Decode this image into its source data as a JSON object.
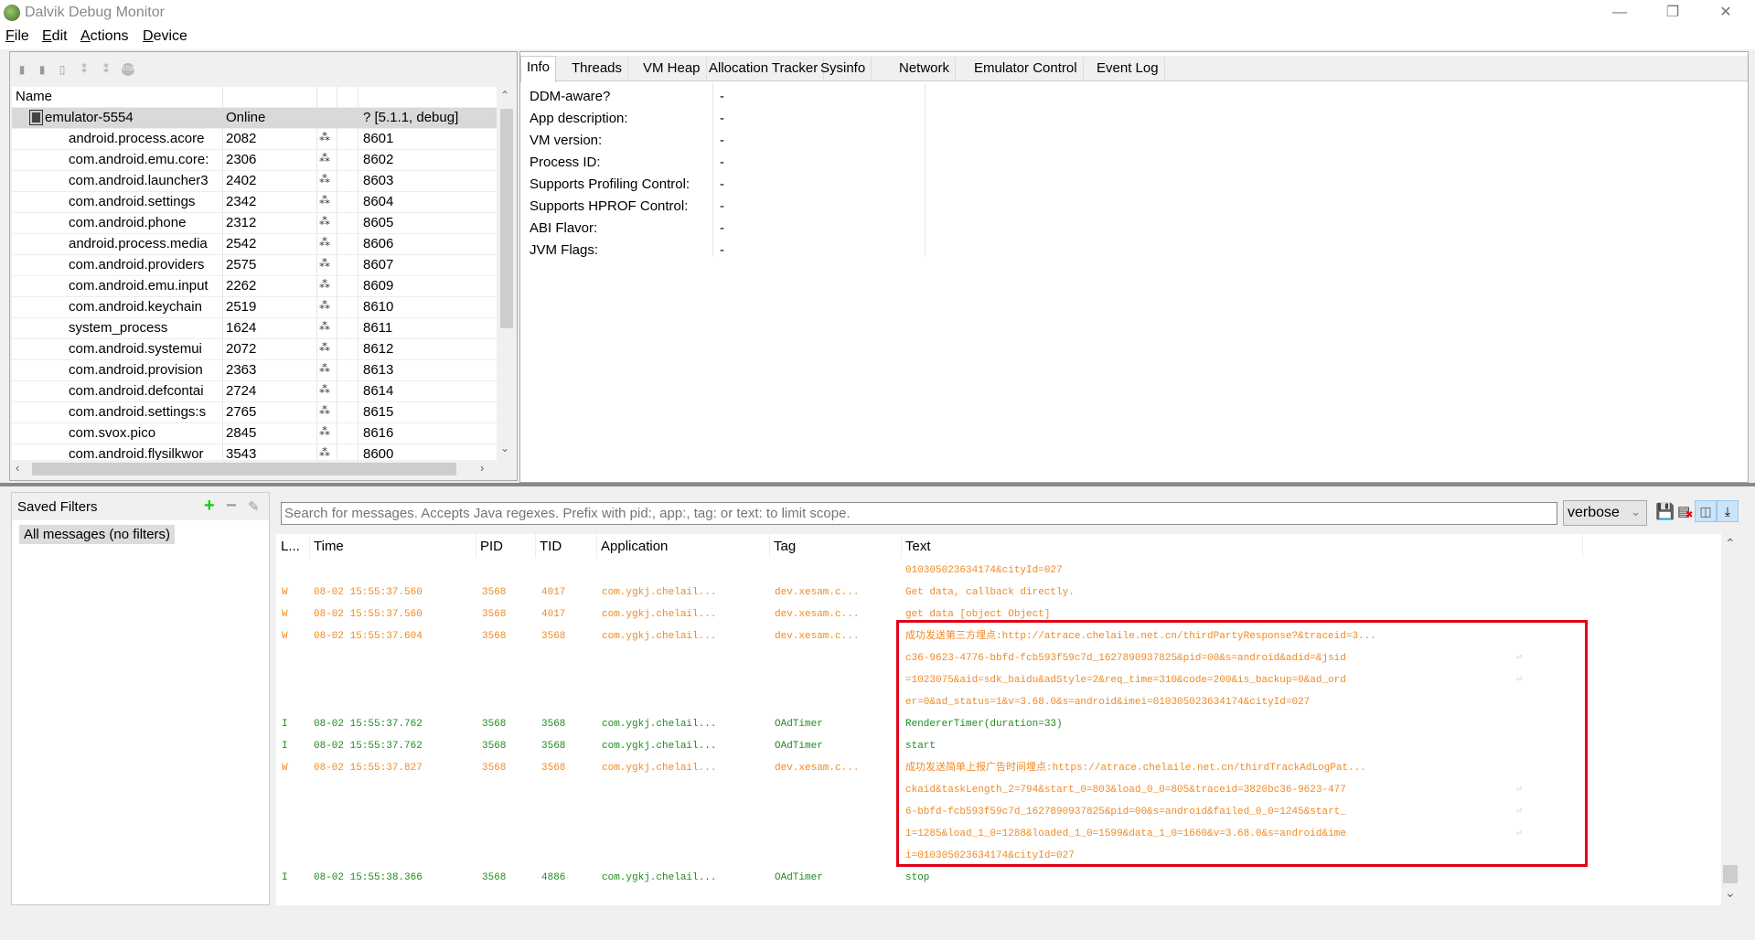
{
  "window": {
    "title": "Dalvik Debug Monitor",
    "minimize": "—",
    "maximize": "❐",
    "close": "✕"
  },
  "menu": [
    {
      "key": "F",
      "rest": "ile"
    },
    {
      "key": "E",
      "rest": "dit"
    },
    {
      "key": "A",
      "rest": "ctions"
    },
    {
      "key": "D",
      "rest": "evice"
    }
  ],
  "devices": {
    "header": {
      "name": "Name"
    },
    "device": {
      "name": "emulator-5554",
      "status": "Online",
      "version": "? [5.1.1, debug]"
    },
    "processes": [
      {
        "name": "android.process.acore",
        "pid": "2082",
        "port": "8601"
      },
      {
        "name": "com.android.emu.core:",
        "pid": "2306",
        "port": "8602"
      },
      {
        "name": "com.android.launcher3",
        "pid": "2402",
        "port": "8603"
      },
      {
        "name": "com.android.settings",
        "pid": "2342",
        "port": "8604"
      },
      {
        "name": "com.android.phone",
        "pid": "2312",
        "port": "8605"
      },
      {
        "name": "android.process.media",
        "pid": "2542",
        "port": "8606"
      },
      {
        "name": "com.android.providers",
        "pid": "2575",
        "port": "8607"
      },
      {
        "name": "com.android.emu.input",
        "pid": "2262",
        "port": "8609"
      },
      {
        "name": "com.android.keychain",
        "pid": "2519",
        "port": "8610"
      },
      {
        "name": "system_process",
        "pid": "1624",
        "port": "8611"
      },
      {
        "name": "com.android.systemui",
        "pid": "2072",
        "port": "8612"
      },
      {
        "name": "com.android.provision",
        "pid": "2363",
        "port": "8613"
      },
      {
        "name": "com.android.defcontai",
        "pid": "2724",
        "port": "8614"
      },
      {
        "name": "com.android.settings:s",
        "pid": "2765",
        "port": "8615"
      },
      {
        "name": "com.svox.pico",
        "pid": "2845",
        "port": "8616"
      },
      {
        "name": "com.android.flysilkwor",
        "pid": "3543",
        "port": "8600"
      }
    ]
  },
  "tabs": [
    "Info",
    "Threads",
    "VM Heap",
    "Allocation Tracker",
    "Sysinfo",
    "Network",
    "Emulator Control",
    "Event Log"
  ],
  "info": [
    {
      "label": "DDM-aware?",
      "value": "-"
    },
    {
      "label": "App description:",
      "value": "-"
    },
    {
      "label": "VM version:",
      "value": "-"
    },
    {
      "label": "Process ID:",
      "value": "-"
    },
    {
      "label": "Supports Profiling Control:",
      "value": "-"
    },
    {
      "label": "Supports HPROF Control:",
      "value": "-"
    },
    {
      "label": "ABI Flavor:",
      "value": "-"
    },
    {
      "label": "JVM Flags:",
      "value": "-"
    }
  ],
  "filters": {
    "title": "Saved Filters",
    "items": [
      "All messages (no filters)"
    ]
  },
  "logcat": {
    "search_placeholder": "Search for messages. Accepts Java regexes. Prefix with pid:, app:, tag: or text: to limit scope.",
    "level_select": "verbose",
    "columns": [
      "L...",
      "Time",
      "PID",
      "TID",
      "Application",
      "Tag",
      "Text"
    ],
    "colors": {
      "W": "#f08a24",
      "I": "#1e8c1e",
      "highlight": "#e00018"
    },
    "entries": [
      {
        "level": "",
        "time": "",
        "pid": "",
        "tid": "",
        "app": "",
        "tag": "",
        "lines": [
          "010305023634174&cityId=027"
        ],
        "cls": "W"
      },
      {
        "level": "W",
        "time": "08-02 15:55:37.560",
        "pid": "3568",
        "tid": "4017",
        "app": "com.ygkj.chelail...",
        "tag": "dev.xesam.c...",
        "lines": [
          "Get data, callback directly."
        ],
        "cls": "W"
      },
      {
        "level": "W",
        "time": "08-02 15:55:37.560",
        "pid": "3568",
        "tid": "4017",
        "app": "com.ygkj.chelail...",
        "tag": "dev.xesam.c...",
        "lines": [
          "get data [object Object]"
        ],
        "cls": "W"
      },
      {
        "level": "W",
        "time": "08-02 15:55:37.604",
        "pid": "3568",
        "tid": "3568",
        "app": "com.ygkj.chelail...",
        "tag": "dev.xesam.c...",
        "lines": [
          "成功发送第三方埋点:http://atrace.chelaile.net.cn/thirdPartyResponse?&traceid=3...",
          "c36-9623-4776-bbfd-fcb593f59c7d_1627890937825&pid=00&s=android&adid=&jsid",
          "=1023075&aid=sdk_baidu&adStyle=2&req_time=310&code=200&is_backup=0&ad_ord",
          "er=0&ad_status=1&v=3.68.0&s=android&imei=010305023634174&cityId=027"
        ],
        "cls": "W"
      },
      {
        "level": "I",
        "time": "08-02 15:55:37.762",
        "pid": "3568",
        "tid": "3568",
        "app": "com.ygkj.chelail...",
        "tag": "OAdTimer",
        "lines": [
          "RendererTimer(duration=33)"
        ],
        "cls": "I"
      },
      {
        "level": "I",
        "time": "08-02 15:55:37.762",
        "pid": "3568",
        "tid": "3568",
        "app": "com.ygkj.chelail...",
        "tag": "OAdTimer",
        "lines": [
          "start"
        ],
        "cls": "I"
      },
      {
        "level": "W",
        "time": "08-02 15:55:37.827",
        "pid": "3568",
        "tid": "3568",
        "app": "com.ygkj.chelail...",
        "tag": "dev.xesam.c...",
        "lines": [
          "成功发送简单上报广告时间埋点:https://atrace.chelaile.net.cn/thirdTrackAdLogPat...",
          "ckaid&taskLength_2=794&start_0=803&load_0_0=805&traceid=3820bc36-9623-477",
          "6-bbfd-fcb593f59c7d_1627890937825&pid=00&s=android&failed_0_0=1245&start_",
          "1=1285&load_1_0=1288&loaded_1_0=1599&data_1_0=1660&v=3.68.0&s=android&ime",
          "i=010305023634174&cityId=027"
        ],
        "cls": "W"
      },
      {
        "level": "I",
        "time": "08-02 15:55:38.366",
        "pid": "3568",
        "tid": "4886",
        "app": "com.ygkj.chelail...",
        "tag": "OAdTimer",
        "lines": [
          "stop"
        ],
        "cls": "I"
      }
    ]
  }
}
